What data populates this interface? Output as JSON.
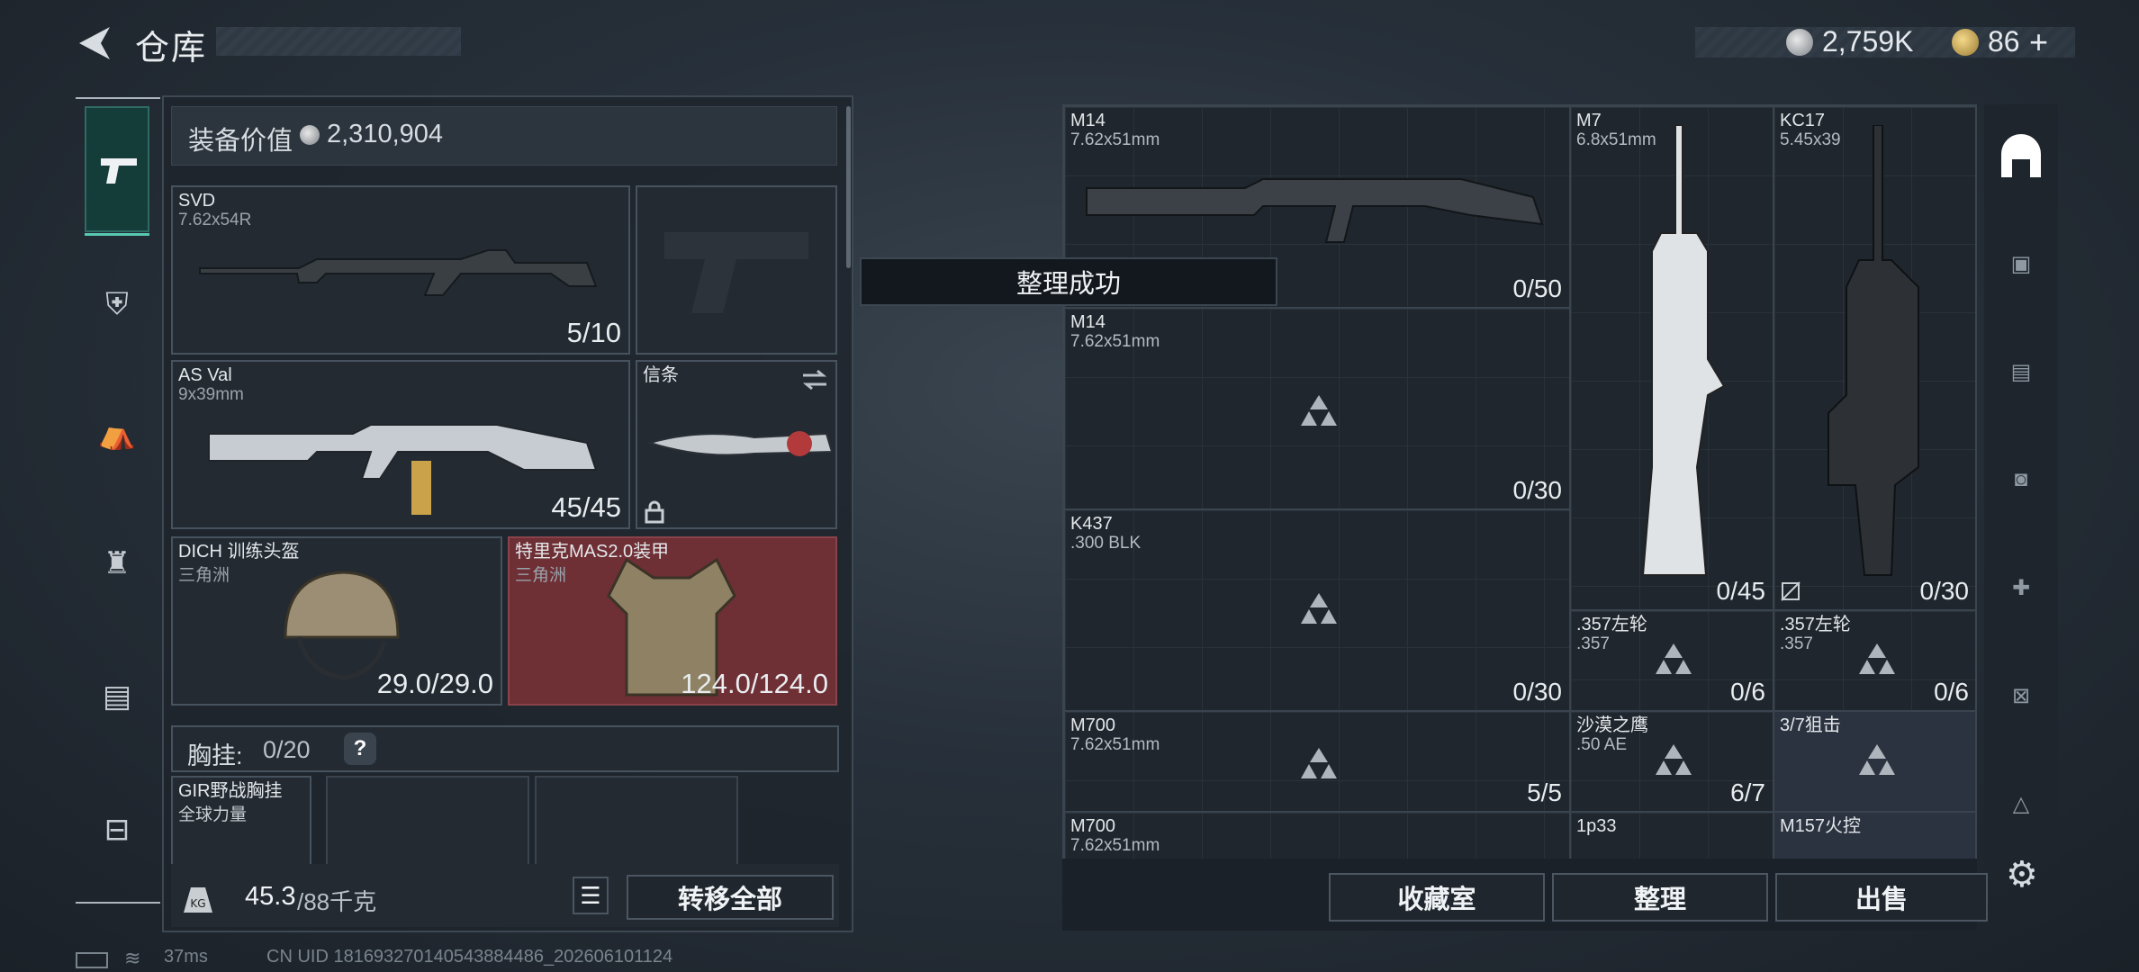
{
  "header": {
    "title": "仓库",
    "currency_silver": "2,759K",
    "currency_gold": "86",
    "plus": "+"
  },
  "equip": {
    "label": "装备价值",
    "value": "2,310,904"
  },
  "slots": [
    {
      "name": "SVD",
      "sub": "7.62x54R",
      "count": "5/10"
    },
    {
      "name": "AS Val",
      "sub": "9x39mm",
      "count": "45/45"
    },
    {
      "name": "信条",
      "sub": "",
      "count": ""
    },
    {
      "name": "DICH 训练头盔",
      "sub": "三角洲",
      "count": "29.0/29.0"
    },
    {
      "name": "特里克MAS2.0装甲",
      "sub": "三角洲",
      "count": "124.0/124.0"
    }
  ],
  "chest": {
    "label": "胸挂:",
    "count": "0/20",
    "help": "?"
  },
  "chest_item": {
    "name": "GIR野战胸挂",
    "sub": "全球力量"
  },
  "weight": {
    "current": "45.3",
    "max": "/88千克"
  },
  "buttons": {
    "transfer_all": "转移全部",
    "collection": "收藏室",
    "organize": "整理",
    "sell": "出售"
  },
  "toast": "整理成功",
  "grid": [
    {
      "name": "M14",
      "sub": "7.62x51mm",
      "count": "0/50"
    },
    {
      "name": "M7",
      "sub": "6.8x51mm",
      "count": "0/45"
    },
    {
      "name": "KC17",
      "sub": "5.45x39",
      "count": "0/30"
    },
    {
      "name": "M14",
      "sub": "7.62x51mm",
      "count": "0/30"
    },
    {
      "name": "K437",
      "sub": ".300 BLK",
      "count": "0/30"
    },
    {
      "name": ".357左轮",
      "sub": ".357",
      "count": "0/6"
    },
    {
      "name": ".357左轮",
      "sub": ".357",
      "count": "0/6"
    },
    {
      "name": "M700",
      "sub": "7.62x51mm",
      "count": "5/5"
    },
    {
      "name": "沙漠之鹰",
      "sub": ".50 AE",
      "count": "6/7"
    },
    {
      "name": "3/7狙击",
      "sub": "",
      "count": ""
    },
    {
      "name": "M700",
      "sub": "7.62x51mm",
      "count": ""
    },
    {
      "name": "1p33",
      "sub": "",
      "count": ""
    },
    {
      "name": "M157火控",
      "sub": "",
      "count": ""
    }
  ],
  "status": {
    "ping": "37ms",
    "uid": "CN UID 181693270140543884486_202606101124"
  },
  "colors": {
    "accent": "#58c7b3",
    "armor_bg": "#6e2f35",
    "cell_bg": "#1f262d"
  }
}
